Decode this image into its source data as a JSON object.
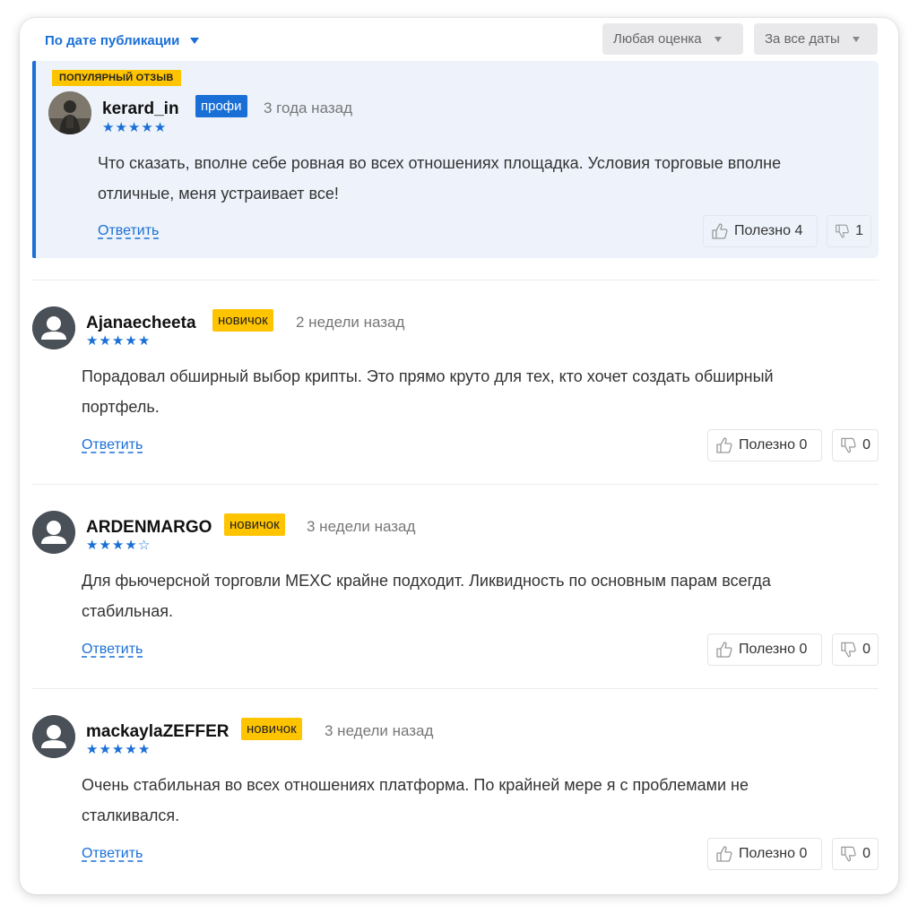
{
  "toolbar": {
    "sort_label": "По дате публикации",
    "rating_filter": "Любая оценка",
    "date_filter": "За все даты"
  },
  "colors": {
    "accent": "#1a6fd6",
    "badge_yellow": "#ffc400",
    "popular_bg": "#eef3fb"
  },
  "popular_badge": "ПОПУЛЯРНЫЙ ОТЗЫВ",
  "reviews": [
    {
      "username": "kerard_in",
      "level": "профи",
      "time": "3 года назад",
      "rating": 5,
      "text_line1": "Что сказать, вполне себе ровная во всех отношениях площадка. Условия торговые вполне",
      "text_line2": "отличные, меня устраивает все!",
      "reply": "Ответить",
      "helpful_label": "Полезно 4",
      "unhelpful_count": "1"
    },
    {
      "username": "Ajanaecheeta",
      "level": "новичок",
      "time": "2 недели назад",
      "rating": 5,
      "text_line1": "Порадовал обширный выбор крипты. Это прямо круто для тех, кто хочет создать обширный",
      "text_line2": "портфель.",
      "reply": "Ответить",
      "helpful_label": "Полезно 0",
      "unhelpful_count": "0"
    },
    {
      "username": "ARDENMARGO",
      "level": "новичок",
      "time": "3 недели назад",
      "rating": 4,
      "text_line1": "Для фьючерсной торговли MEXC крайне подходит. Ликвидность по основным парам всегда",
      "text_line2": "стабильная.",
      "reply": "Ответить",
      "helpful_label": "Полезно 0",
      "unhelpful_count": "0"
    },
    {
      "username": "mackaylaZEFFER",
      "level": "новичок",
      "time": "3 недели назад",
      "rating": 5,
      "text_line1": "Очень стабильная во всех отношениях платформа. По крайней мере я с проблемами не",
      "text_line2": "сталкивался.",
      "reply": "Ответить",
      "helpful_label": "Полезно 0",
      "unhelpful_count": "0"
    }
  ]
}
